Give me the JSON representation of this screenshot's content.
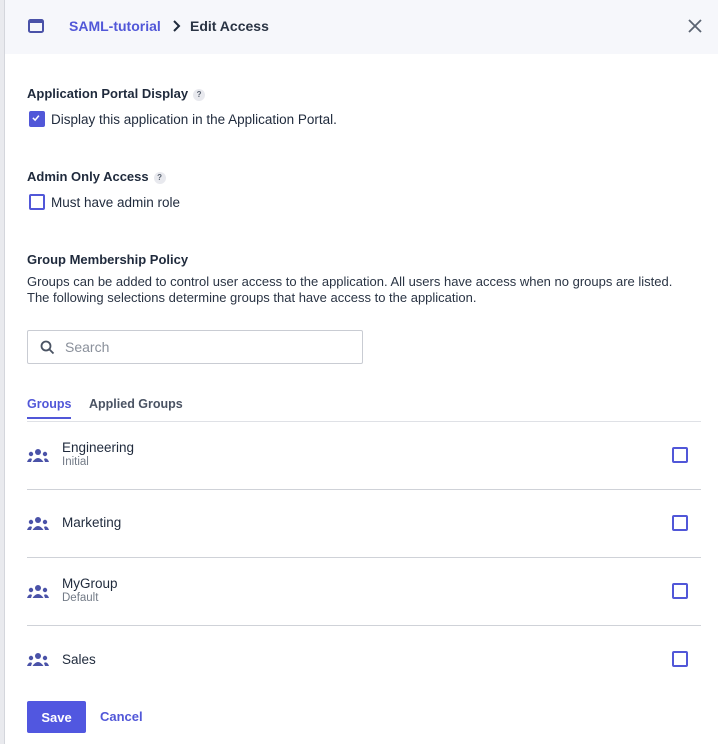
{
  "header": {
    "breadcrumb_parent": "SAML-tutorial",
    "breadcrumb_current": "Edit Access"
  },
  "portal_display": {
    "title": "Application Portal Display",
    "help": "?",
    "checkbox_label": "Display this application in the Application Portal.",
    "checked": true
  },
  "admin_only": {
    "title": "Admin Only Access",
    "help": "?",
    "checkbox_label": "Must have admin role",
    "checked": false
  },
  "group_policy": {
    "title": "Group Membership Policy",
    "description": "Groups can be added to control user access to the application. All users have access when no groups are listed. The following selections determine groups that have access to the application.",
    "search_placeholder": "Search",
    "search_value": ""
  },
  "tabs": [
    {
      "label": "Groups",
      "active": true
    },
    {
      "label": "Applied Groups",
      "active": false
    }
  ],
  "groups": [
    {
      "name": "Engineering",
      "sub": "Initial",
      "checked": false
    },
    {
      "name": "Marketing",
      "sub": "",
      "checked": false
    },
    {
      "name": "MyGroup",
      "sub": "Default",
      "checked": false
    },
    {
      "name": "Sales",
      "sub": "",
      "checked": false
    }
  ],
  "footer": {
    "save_label": "Save",
    "cancel_label": "Cancel"
  },
  "colors": {
    "accent": "#5157d8",
    "header_bg": "#f6f7fb"
  }
}
